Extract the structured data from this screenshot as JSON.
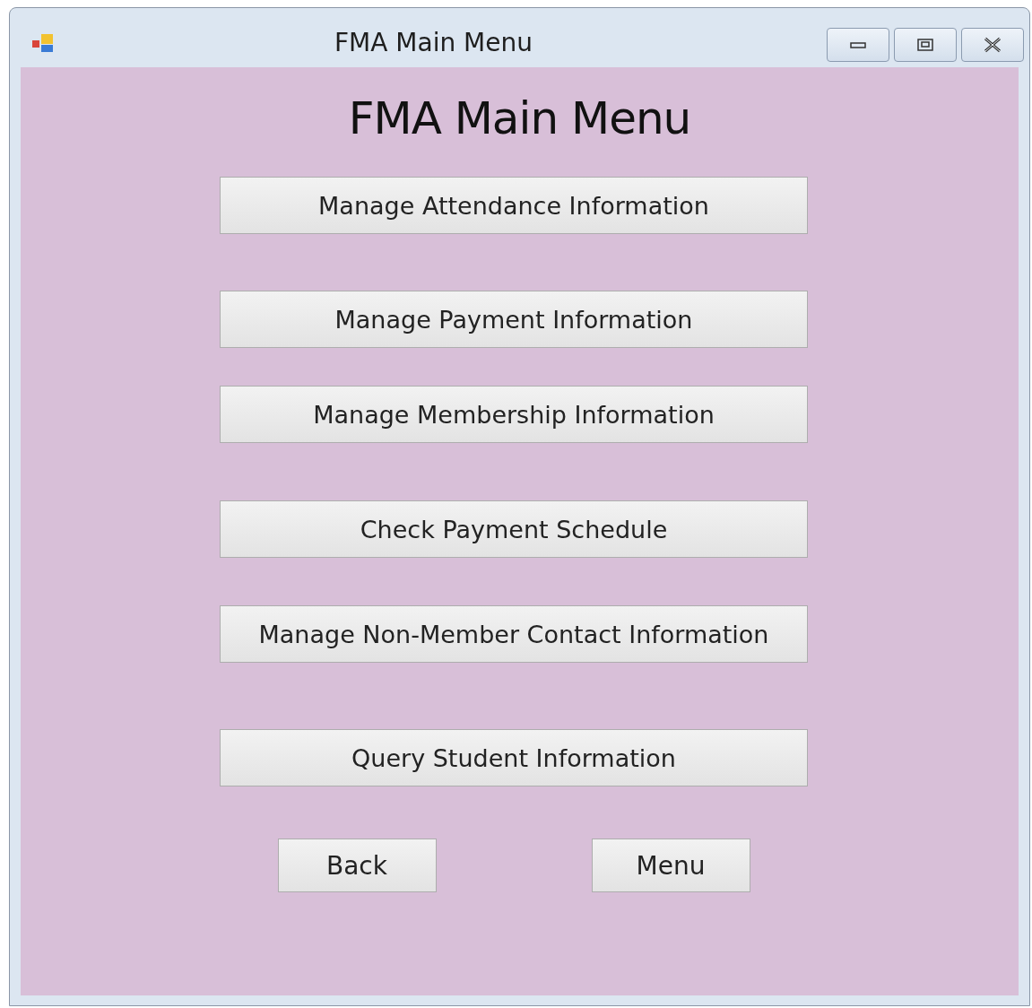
{
  "window": {
    "title": "FMA Main Menu"
  },
  "heading": "FMA Main Menu",
  "menu_buttons": [
    "Manage Attendance Information",
    "Manage Payment Information",
    "Manage Membership Information",
    "Check Payment Schedule",
    "Manage Non-Member Contact Information",
    "Query Student Information"
  ],
  "nav_buttons": [
    "Back",
    "Menu"
  ]
}
